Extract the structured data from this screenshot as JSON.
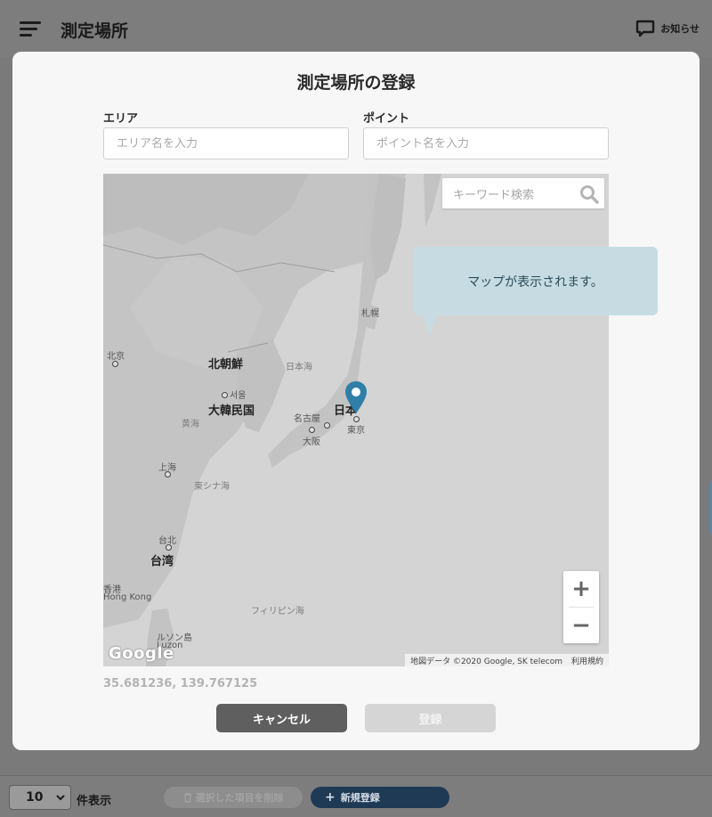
{
  "app": {
    "title": "測定場所",
    "notice_label": "お知らせ"
  },
  "footer": {
    "page_size_value": "10",
    "page_size_unit": "件表示",
    "delete_selected_label": "選択した項目を削除",
    "new_register_label": "新規登録"
  },
  "modal": {
    "title": "測定場所の登録",
    "area": {
      "label": "エリア",
      "placeholder": "エリア名を入力",
      "value": ""
    },
    "point": {
      "label": "ポイント",
      "placeholder": "ポイント名を入力",
      "value": ""
    },
    "map": {
      "search_placeholder": "キーワード検索",
      "labels": {
        "sapporo": "札幌",
        "beijing": "北京",
        "north_korea": "北朝鮮",
        "sea_of_japan": "日本海",
        "seoul": "서울",
        "south_korea": "大韓民国",
        "yellow_sea": "黄海",
        "japan": "日本",
        "nagoya": "名古屋",
        "osaka": "大阪",
        "tokyo": "東京",
        "shanghai": "上海",
        "east_china_sea": "東シナ海",
        "taipei": "台北",
        "taiwan": "台湾",
        "hk_zh": "香港",
        "hong_kong": "Hong Kong",
        "philippine_sea": "フィリピン海",
        "luzon_ja": "ルソン島",
        "luzon": "Luzon"
      },
      "google_logo": "Google",
      "attribution": "地図データ ©2020 Google, SK telecom",
      "terms": "利用規約",
      "zoom_in": "+",
      "zoom_out": "−"
    },
    "coordinates": "35.681236, 139.767125",
    "cancel_label": "キャンセル",
    "register_label": "登録"
  },
  "tooltip": {
    "text": "マップが表示されます。"
  },
  "colors": {
    "primary_dark": "#5f5f5f",
    "disabled": "#d5d5d5",
    "pin": "#2f7fa8",
    "tooltip_bg": "#c6dce2",
    "new_button": "#1e3a55"
  }
}
